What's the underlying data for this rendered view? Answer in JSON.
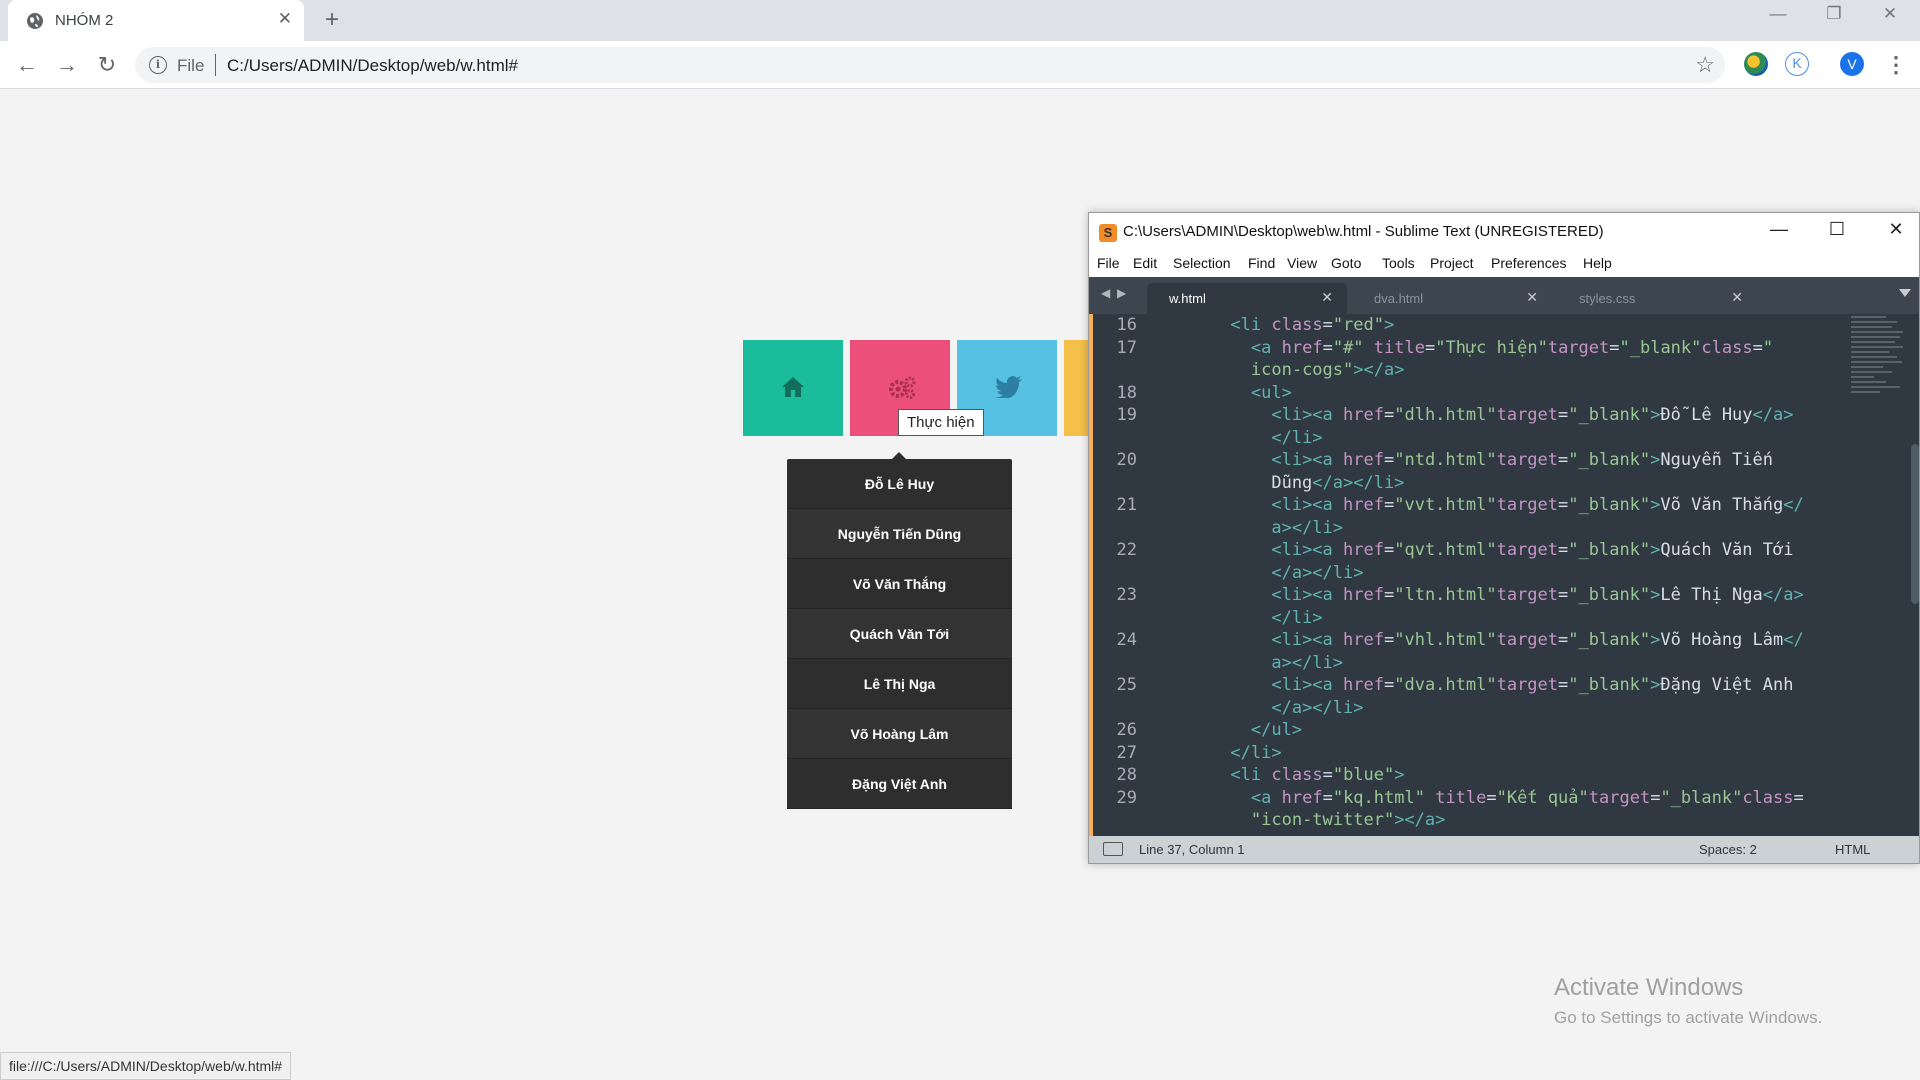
{
  "browser": {
    "tab_title": "NHÓM 2",
    "new_tab": "+",
    "close_tab": "✕",
    "address_scheme": "File",
    "address_url": "C:/Users/ADMIN/Desktop/web/w.html#",
    "status_url": "file:///C:/Users/ADMIN/Desktop/web/w.html#",
    "profile_initial": "V",
    "extension_k": "K"
  },
  "page": {
    "tiles": [
      {
        "color": "#1abc9c",
        "icon": "home-icon"
      },
      {
        "color": "#ec4f7a",
        "icon": "cogs-icon"
      },
      {
        "color": "#56c1e3",
        "icon": "twitter-icon"
      },
      {
        "color": "#f5c04a",
        "icon": "partial-tile"
      }
    ],
    "tooltip": "Thực hiện",
    "submenu": [
      "Đỗ Lê Huy",
      "Nguyễn Tiến Dũng",
      "Võ Văn Thắng",
      "Quách Văn Tới",
      "Lê Thị Nga",
      "Võ Hoàng Lâm",
      "Đặng Việt Anh"
    ]
  },
  "watermark": {
    "title": "Activate Windows",
    "subtitle": "Go to Settings to activate Windows."
  },
  "sublime": {
    "title": "C:\\Users\\ADMIN\\Desktop\\web\\w.html - Sublime Text (UNREGISTERED)",
    "menu": [
      "File",
      "Edit",
      "Selection",
      "Find",
      "View",
      "Goto",
      "Tools",
      "Project",
      "Preferences",
      "Help"
    ],
    "tabs": [
      "w.html",
      "dva.html",
      "styles.css"
    ],
    "status_position": "Line 37, Column 1",
    "status_spaces": "Spaces: 2",
    "status_syntax": "HTML"
  }
}
